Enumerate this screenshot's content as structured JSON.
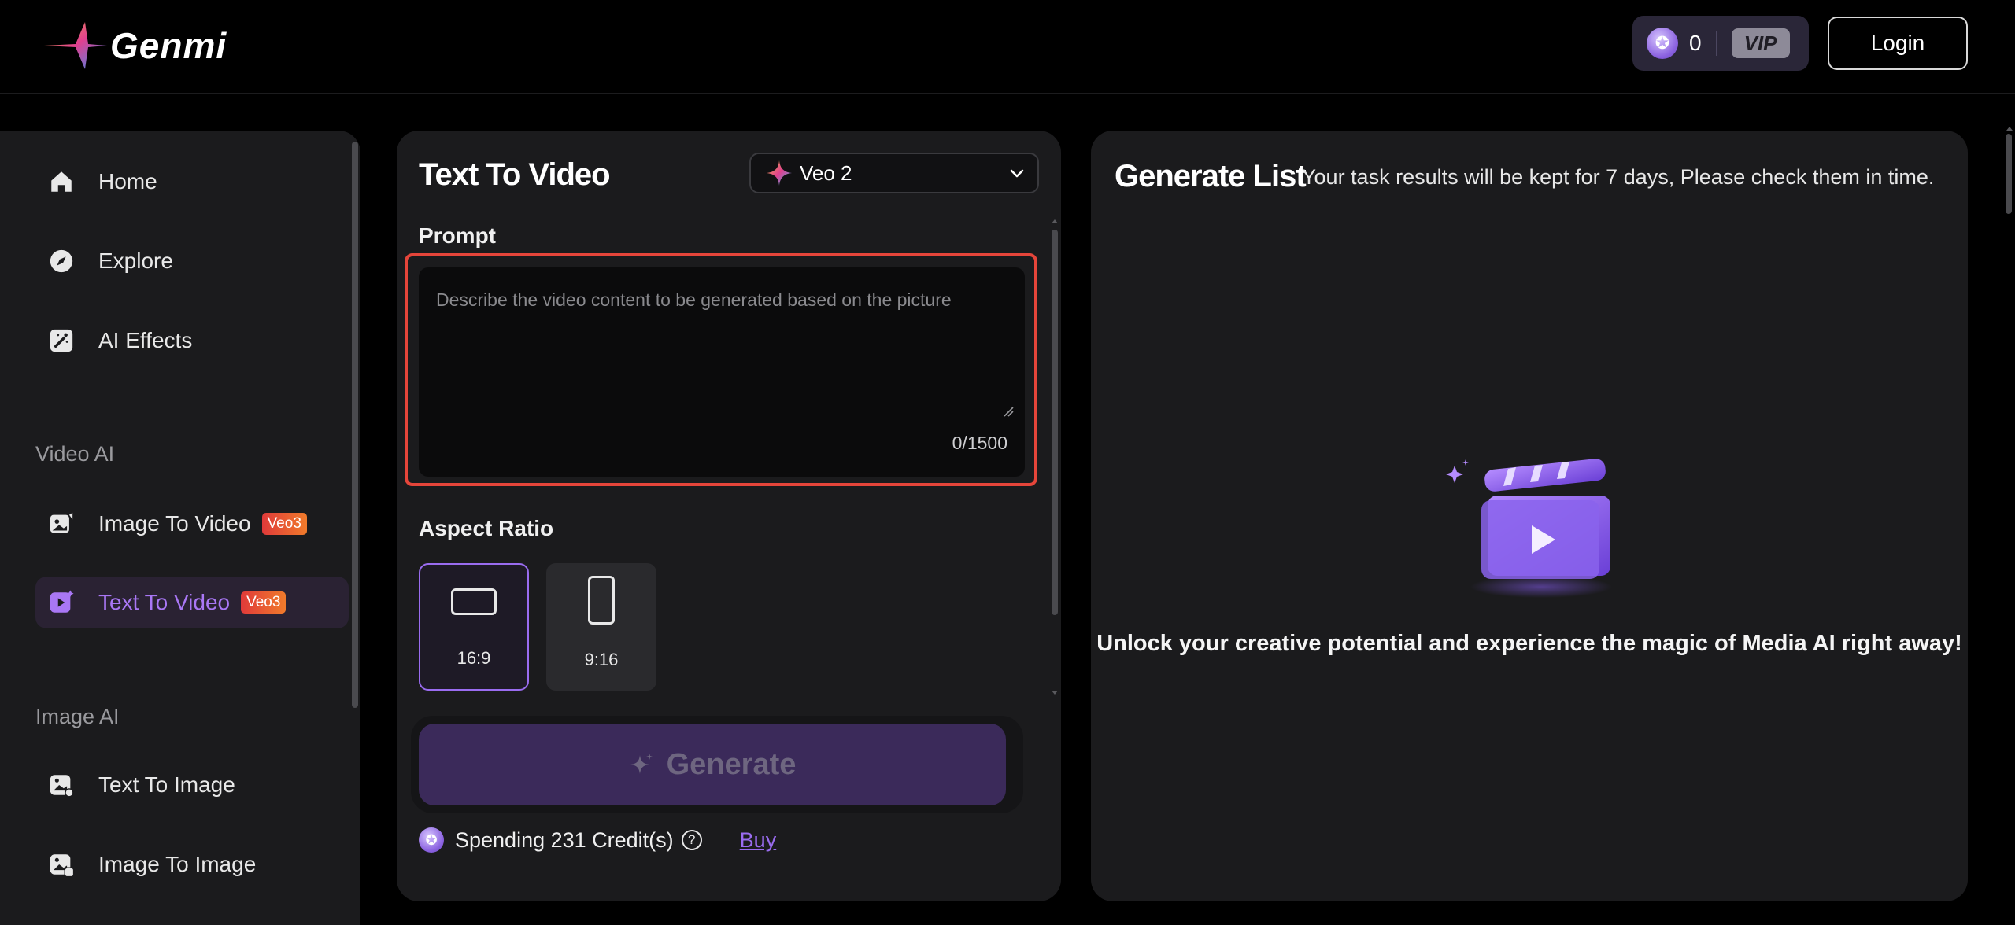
{
  "header": {
    "brand": "Genmi",
    "credits": "0",
    "vip_label": "VIP",
    "login_label": "Login"
  },
  "sidebar": {
    "items": [
      {
        "label": "Home",
        "icon": "home-icon"
      },
      {
        "label": "Explore",
        "icon": "compass-icon"
      },
      {
        "label": "AI Effects",
        "icon": "magic-wand-icon"
      }
    ],
    "video_section_title": "Video AI",
    "video_items": [
      {
        "label": "Image To Video",
        "badge": "Veo3",
        "icon": "image-video-icon"
      },
      {
        "label": "Text To Video",
        "badge": "Veo3",
        "icon": "play-sparkle-icon",
        "active": true
      }
    ],
    "image_section_title": "Image AI",
    "image_items": [
      {
        "label": "Text To Image",
        "icon": "text-image-icon"
      },
      {
        "label": "Image To Image",
        "icon": "image-image-icon"
      }
    ]
  },
  "generator": {
    "title": "Text To Video",
    "model": "Veo 2",
    "prompt_label": "Prompt",
    "prompt_placeholder": "Describe the video content to be generated based on the picture",
    "prompt_value": "",
    "char_count": "0/1500",
    "aspect_label": "Aspect Ratio",
    "ratios": [
      {
        "label": "16:9",
        "selected": true
      },
      {
        "label": "9:16",
        "selected": false
      }
    ],
    "generate_label": "Generate",
    "spending_text": "Spending 231 Credit(s)",
    "help_symbol": "?",
    "buy_label": "Buy"
  },
  "results": {
    "title": "Generate List",
    "subtitle": "Your task results will be kept for 7 days, Please check them in time.",
    "empty_message": "Unlock your creative potential and experience the magic of Media AI right away!"
  },
  "colors": {
    "accent": "#9a6cf0",
    "highlight_border": "#e5453a",
    "badge_start": "#e03a3a",
    "badge_end": "#f07b2b"
  }
}
